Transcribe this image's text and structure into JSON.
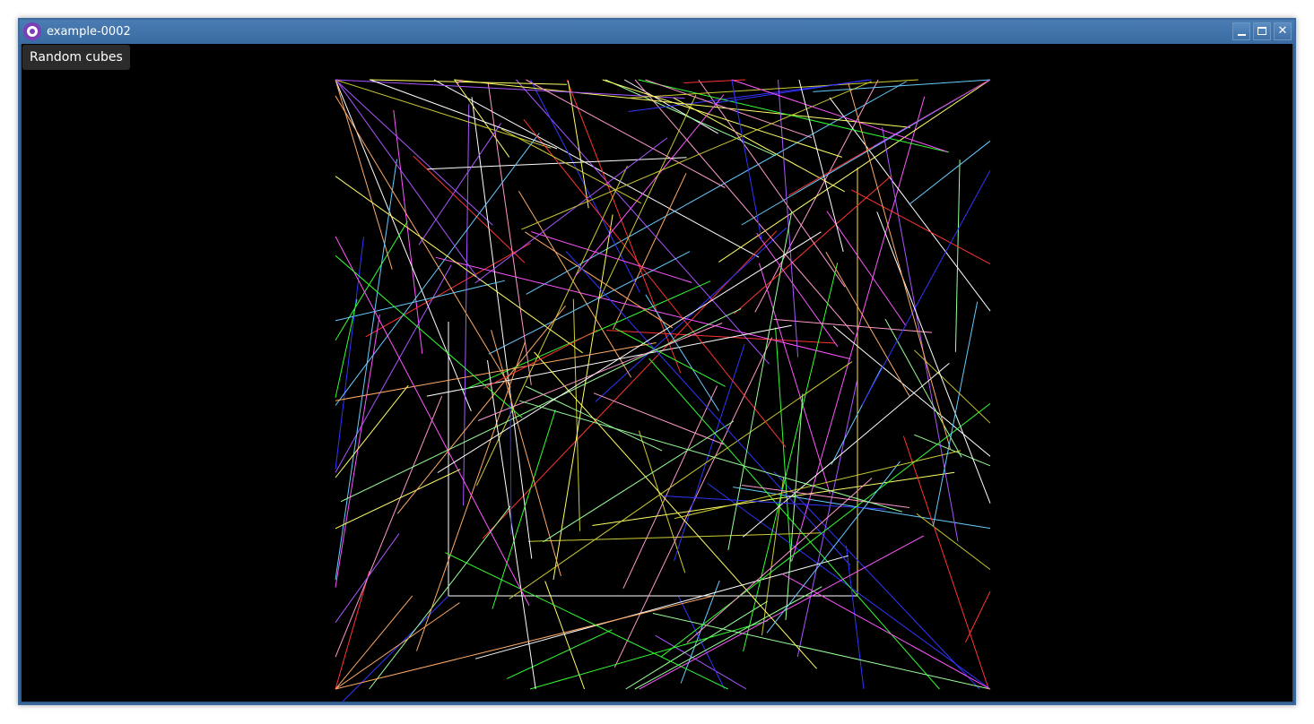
{
  "window": {
    "title": "example-0002",
    "buttons": {
      "minimize_icon": "minimize-icon",
      "maximize_icon": "maximize-icon",
      "close_icon": "close-icon",
      "close_glyph": "✕"
    },
    "colors": {
      "titlebar": "#3a6aa0",
      "background": "#000000",
      "app_icon": "#7b3fb8"
    }
  },
  "scene": {
    "label": "Random cubes",
    "line_colors": [
      "#ffffff",
      "#3333ff",
      "#33ff33",
      "#ffff66",
      "#ff3333",
      "#ff55ff",
      "#66ccff",
      "#ffaa66",
      "#aa55ff",
      "#99ff99",
      "#ff99cc",
      "#cccc33"
    ]
  }
}
